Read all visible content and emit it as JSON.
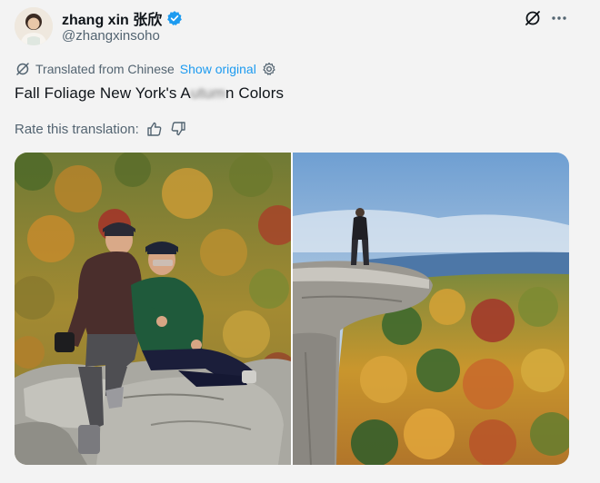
{
  "author": {
    "display_name": "zhang xin 张欣",
    "handle": "@zhangxinsoho",
    "avatar_alt": "avatar"
  },
  "icons": {
    "grok": "grok-icon",
    "more": "more-icon",
    "translate": "translate-icon",
    "gear": "gear-icon",
    "thumbs_up": "thumbs-up-icon",
    "thumbs_down": "thumbs-down-icon",
    "verified": "verified-badge-icon"
  },
  "translation": {
    "label": "Translated from Chinese",
    "show_original": "Show original"
  },
  "tweet": {
    "text_before": "Fall Foliage New York's A",
    "text_blurred": "utum",
    "text_after": "n Colors"
  },
  "rate": {
    "label": "Rate this translation:"
  },
  "colors": {
    "accent": "#1d9bf0",
    "secondary_text": "#536471",
    "primary_text": "#0f1419"
  }
}
